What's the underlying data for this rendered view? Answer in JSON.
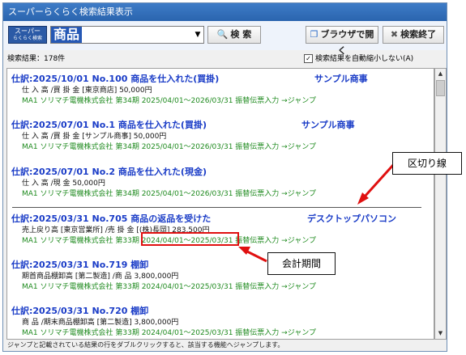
{
  "window": {
    "title": "スーパーらくらく検索結果表示"
  },
  "toolbar": {
    "logo_line1": "スーパー",
    "logo_line2": "らくらく検索",
    "search_value": "商品",
    "dropdown_icon": "chevron-down-icon",
    "search_label": "検 索",
    "browser_label": "ブラウザで開く",
    "exit_label": "検索終了"
  },
  "status": {
    "count_text": "検索結果：178件",
    "auto_shrink_label": "検索結果を自動縮小しない(A)",
    "auto_shrink_checked": true
  },
  "results": [
    {
      "heading": "仕訳:2025/10/01 No.100 商品を仕入れた(買掛)",
      "partner": "サンプル商事",
      "detail": "仕 入 高 /買 掛 金 [東京商店] 50,000円",
      "jump_prefix": "MA1 ソリマチ電機株式会社 第34期 ",
      "period": "2025/04/01～2026/03/31",
      "jump_suffix": " 振替伝票入力 →ジャンプ"
    },
    {
      "heading": "仕訳:2025/07/01 No.1 商品を仕入れた(買掛)",
      "partner": "サンプル商事",
      "detail": "仕 入 高 /買 掛 金 [サンプル商事] 50,000円",
      "jump_prefix": "MA1 ソリマチ電機株式会社 第34期 ",
      "period": "2025/04/01～2026/03/31",
      "jump_suffix": " 振替伝票入力 →ジャンプ"
    },
    {
      "heading": "仕訳:2025/07/01 No.2 商品を仕入れた(現金)",
      "partner": "",
      "detail": "仕 入 高 /現 金 50,000円",
      "jump_prefix": "MA1 ソリマチ電機株式会社 第34期 ",
      "period": "2025/04/01～2026/03/31",
      "jump_suffix": " 振替伝票入力 →ジャンプ"
    },
    {
      "heading": "仕訳:2025/03/31 No.705 商品の返品を受けた",
      "partner": "デスクトップパソコン",
      "detail": "売上戻り高 [東京営業所] /売 掛 金 [(株)長岡] 283,500円",
      "jump_prefix": "MA1 ソリマチ電機株式会社 第33期 ",
      "period": "2024/04/01～2025/03/31",
      "jump_suffix": " 振替伝票入力 →ジャンプ"
    },
    {
      "heading": "仕訳:2025/03/31 No.719 棚卸",
      "partner": "",
      "detail": "期首商品棚卸高 [第二製造] /商 品 3,800,000円",
      "jump_prefix": "MA1 ソリマチ電機株式会社 第33期 ",
      "period": "2024/04/01～2025/03/31",
      "jump_suffix": " 振替伝票入力 →ジャンプ"
    },
    {
      "heading": "仕訳:2025/03/31 No.720 棚卸",
      "partner": "",
      "detail": "商 品 /期末商品棚卸高 [第二製造] 3,800,000円",
      "jump_prefix": "MA1 ソリマチ電機株式会社 第33期 ",
      "period": "2024/04/01～2025/03/31",
      "jump_suffix": " 振替伝票入力 →ジャンプ"
    }
  ],
  "footer": {
    "hint": "ジャンプと記載されている結果の行をダブルクリックすると、該当する機能へジャンプします。"
  },
  "annotations": {
    "separator_label": "区切り線",
    "period_label": "会計期間",
    "color": "#e01010"
  }
}
